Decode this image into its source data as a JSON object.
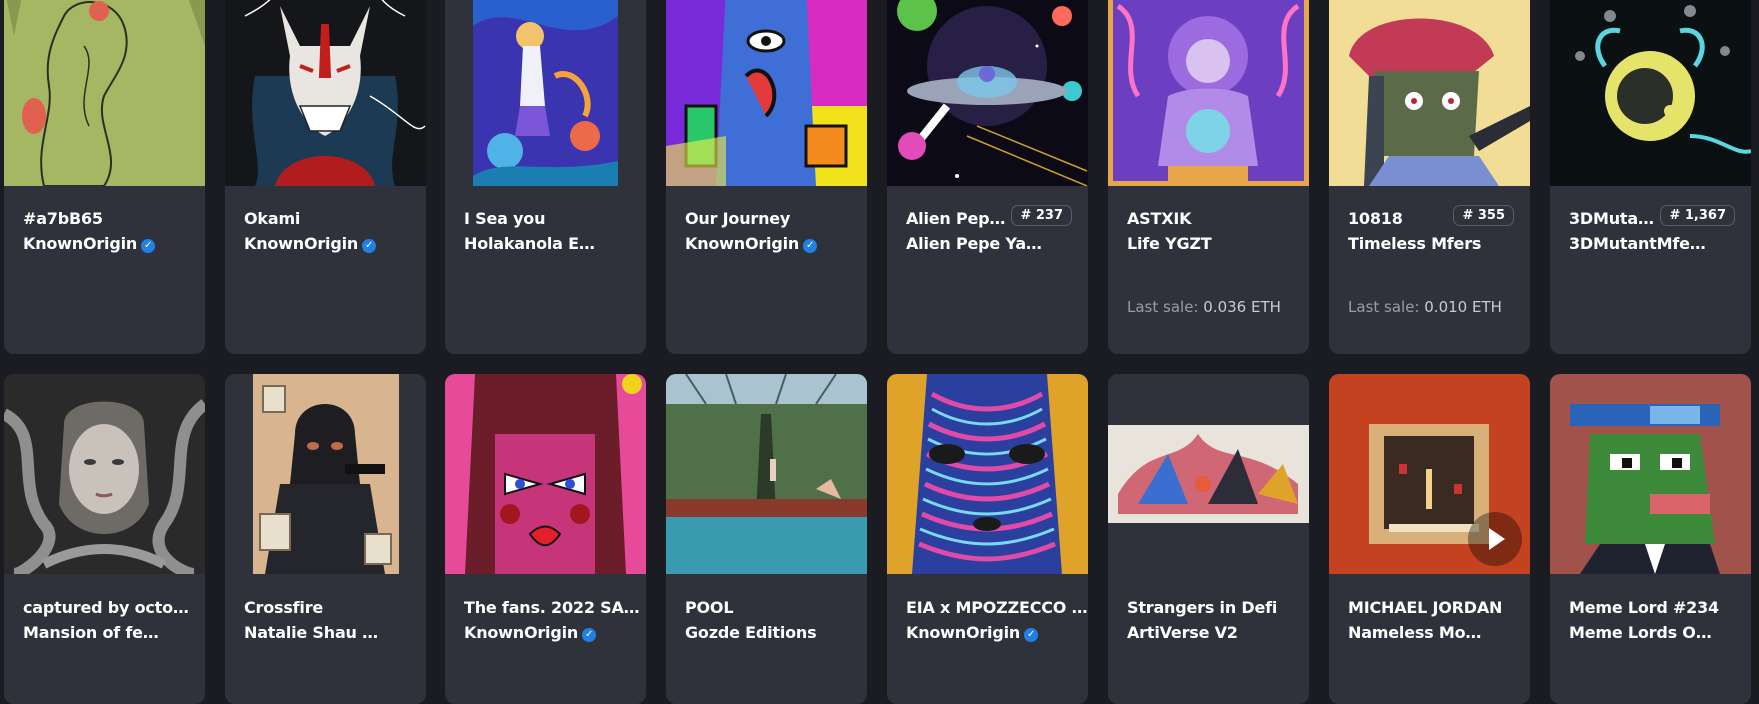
{
  "cards": [
    {
      "name": "#a7bB65",
      "collection": "KnownOrigin",
      "verified": true
    },
    {
      "name": "Okami",
      "collection": "KnownOrigin",
      "verified": true
    },
    {
      "name": "I Sea you",
      "collection": "Holakanola E…",
      "verified": false
    },
    {
      "name": "Our Journey",
      "collection": "KnownOrigin",
      "verified": true
    },
    {
      "name": "Alien Pep…",
      "collection": "Alien Pepe Ya…",
      "verified": false,
      "badge": "# 237"
    },
    {
      "name": "ASTXIK",
      "collection": "Life YGZT",
      "verified": false,
      "last_sale_label": "Last sale:",
      "last_sale_value": "0.036 ETH"
    },
    {
      "name": "10818",
      "collection": "Timeless Mfers",
      "verified": false,
      "badge": "# 355",
      "last_sale_label": "Last sale:",
      "last_sale_value": "0.010 ETH"
    },
    {
      "name": "3DMuta…",
      "collection": "3DMutantMfe…",
      "verified": false,
      "badge": "# 1,367"
    },
    {
      "name": "captured by octo…",
      "collection": "Mansion of fe…",
      "verified": false
    },
    {
      "name": "Crossfire",
      "collection": "Natalie Shau …",
      "verified": false
    },
    {
      "name": "The fans. 2022 SA…",
      "collection": "KnownOrigin",
      "verified": true
    },
    {
      "name": "POOL",
      "collection": "Gozde Editions",
      "verified": false
    },
    {
      "name": "EIA x MPOZZECCO …",
      "collection": "KnownOrigin",
      "verified": true
    },
    {
      "name": "Strangers in Defi",
      "collection": "ArtiVerse V2",
      "verified": false
    },
    {
      "name": "MICHAEL JORDAN",
      "collection": "Nameless Mo…",
      "verified": false,
      "has_video": true
    },
    {
      "name": "Meme Lord #234",
      "collection": "Meme Lords O…",
      "verified": false
    }
  ],
  "icons": {
    "verified": "✓"
  },
  "colors": {
    "background": "#1b1c21",
    "card": "#30323b",
    "verified": "#2081e2",
    "muted_text": "#9a9ca5"
  }
}
